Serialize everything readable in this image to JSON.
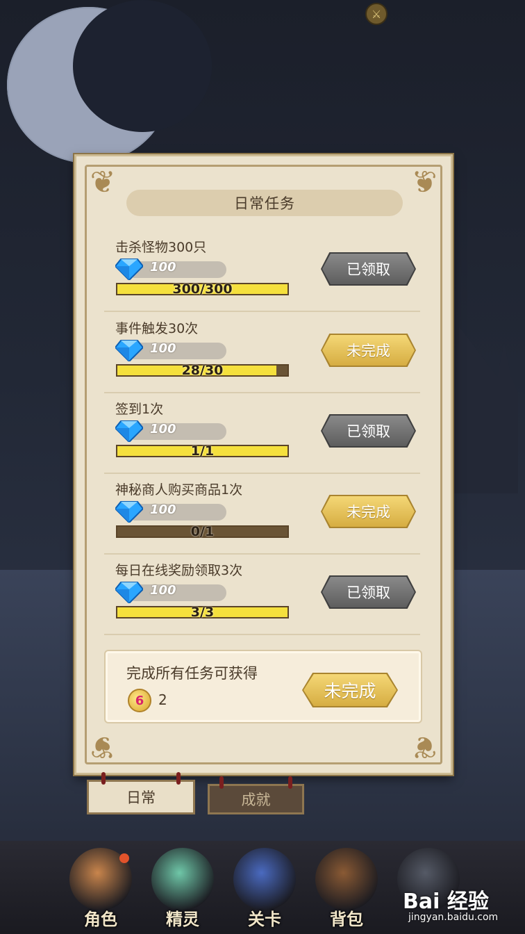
{
  "panel": {
    "title": "日常任务",
    "tasks": [
      {
        "name": "击杀怪物300只",
        "reward": "100",
        "progress_text": "300/300",
        "progress": 1.0,
        "button": "已领取",
        "state": "done"
      },
      {
        "name": "事件触发30次",
        "reward": "100",
        "progress_text": "28/30",
        "progress": 0.933,
        "button": "未完成",
        "state": "pending"
      },
      {
        "name": "签到1次",
        "reward": "100",
        "progress_text": "1/1",
        "progress": 1.0,
        "button": "已领取",
        "state": "done"
      },
      {
        "name": "神秘商人购买商品1次",
        "reward": "100",
        "progress_text": "0/1",
        "progress": 0.0,
        "button": "未完成",
        "state": "pending"
      },
      {
        "name": "每日在线奖励领取3次",
        "reward": "100",
        "progress_text": "3/3",
        "progress": 1.0,
        "button": "已领取",
        "state": "done"
      }
    ],
    "all_complete": {
      "label": "完成所有任务可获得",
      "count": "2",
      "coin_symbol": "6",
      "button": "未完成"
    }
  },
  "tabs": {
    "daily": "日常",
    "achievements": "成就"
  },
  "nav": [
    {
      "label": "角色",
      "icon": "character-icon",
      "color": "#c9854c"
    },
    {
      "label": "精灵",
      "icon": "spirit-icon",
      "color": "#6fc7a8"
    },
    {
      "label": "关卡",
      "icon": "stage-icon",
      "color": "#4a6ac0"
    },
    {
      "label": "背包",
      "icon": "backpack-icon",
      "color": "#8a5a34"
    },
    {
      "label": "",
      "icon": "locked-icon",
      "color": "#555a66"
    }
  ],
  "watermark": {
    "text": "Bai 经验",
    "sub": "jingyan.baidu.com"
  },
  "colors": {
    "gold": "#f5e03d",
    "parchment": "#ebe2cd",
    "button_done": "#6e6e6e",
    "button_pending": "#e6c35a"
  }
}
